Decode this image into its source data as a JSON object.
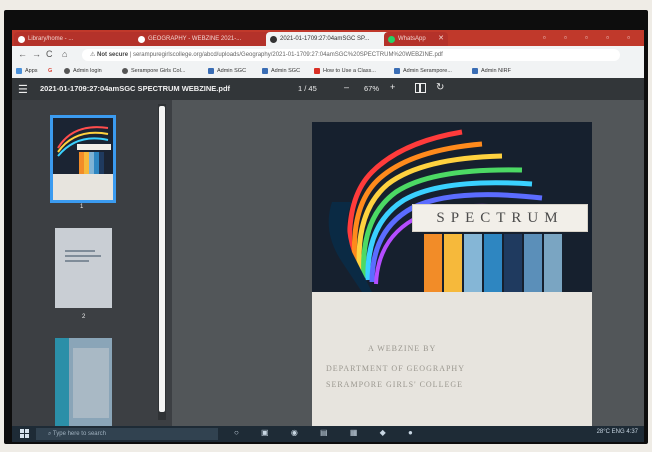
{
  "tabs": [
    {
      "label": "Library/home - ...",
      "active": false
    },
    {
      "label": "GEOGRAPHY - WEBZINE 2021-...",
      "active": false
    },
    {
      "label": "2021-01-1709:27:04amSGC SP...",
      "active": true
    },
    {
      "label": "WhatsApp",
      "active": false
    }
  ],
  "address": {
    "security": "Not secure",
    "url": "serampuregirlscollege.org/abcd/uploads/Geography/2021-01-1709:27:04amSGC%20SPECTRUM%20WEBZINE.pdf"
  },
  "bookmarks": [
    {
      "label": "Apps",
      "color": "#4a90d9"
    },
    {
      "label": "G",
      "color": "#db4437"
    },
    {
      "label": "Admin login",
      "color": "#555"
    },
    {
      "label": "Serampore Girls Col...",
      "color": "#555"
    },
    {
      "label": "Admin SGC",
      "color": "#3a6db4"
    },
    {
      "label": "Admin SGC",
      "color": "#3a6db4"
    },
    {
      "label": "How to Use a Class...",
      "color": "#d93025"
    },
    {
      "label": "Admin Serampore...",
      "color": "#3a6db4"
    },
    {
      "label": "Admin NIRF",
      "color": "#3a6db4"
    }
  ],
  "pdf": {
    "filename": "2021-01-1709:27:04amSGC SPECTRUM WEBZINE.pdf",
    "page_indicator": "1 / 45",
    "zoom": "67%",
    "zoom_out": "–",
    "zoom_in": "+"
  },
  "thumbnails": [
    "1",
    "2"
  ],
  "cover": {
    "title": "SPECTRUM",
    "line1": "A WEBZINE BY",
    "line2": "DEPARTMENT OF GEOGRAPHY",
    "line3": "SERAMPORE GIRLS' COLLEGE"
  },
  "taskbar": {
    "search_placeholder": "Type here to search",
    "tray": "28°C  ENG  4:37"
  },
  "colors": {
    "tabbar": "#c0392b",
    "pdf_toolbar": "#323639",
    "thumb_selected": "#3b9bf0"
  }
}
